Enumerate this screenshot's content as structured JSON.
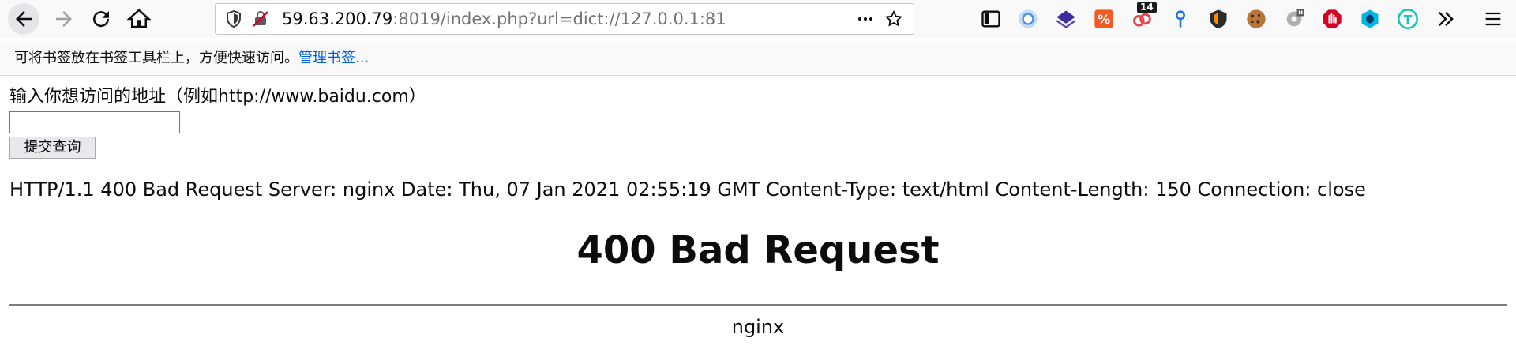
{
  "toolbar": {
    "url_host": "59.63.200.79",
    "url_rest": ":8019/index.php?url=dict://127.0.0.1:81",
    "ext_badge": "14",
    "icons": [
      "back-icon",
      "forward-icon",
      "reload-icon",
      "home-icon",
      "shield-icon",
      "insecure-lock-icon",
      "more-icon",
      "star-icon",
      "sidebar-icon",
      "circle-extension-icon",
      "layers-extension-icon",
      "percent-extension-icon",
      "rings-extension-icon",
      "pin-extension-icon",
      "shield-orange-extension-icon",
      "cookie-extension-icon",
      "gear-extension-icon",
      "stop-hand-extension-icon",
      "cube-extension-icon",
      "teal-t-extension-icon",
      "chevron-double-right-icon",
      "menu-icon"
    ]
  },
  "bookmarks": {
    "hint_text": "可将书签放在书签工具栏上，方便快速访问。",
    "manage_link": "管理书签..."
  },
  "page": {
    "prompt": "输入你想访问的地址（例如http://www.baidu.com）",
    "input_value": "",
    "submit_label": "提交查询",
    "response_text": "HTTP/1.1 400 Bad Request Server: nginx Date: Thu, 07 Jan 2021 02:55:19 GMT Content-Type: text/html Content-Length: 150 Connection: close",
    "heading": "400 Bad Request",
    "footer": "nginx"
  }
}
